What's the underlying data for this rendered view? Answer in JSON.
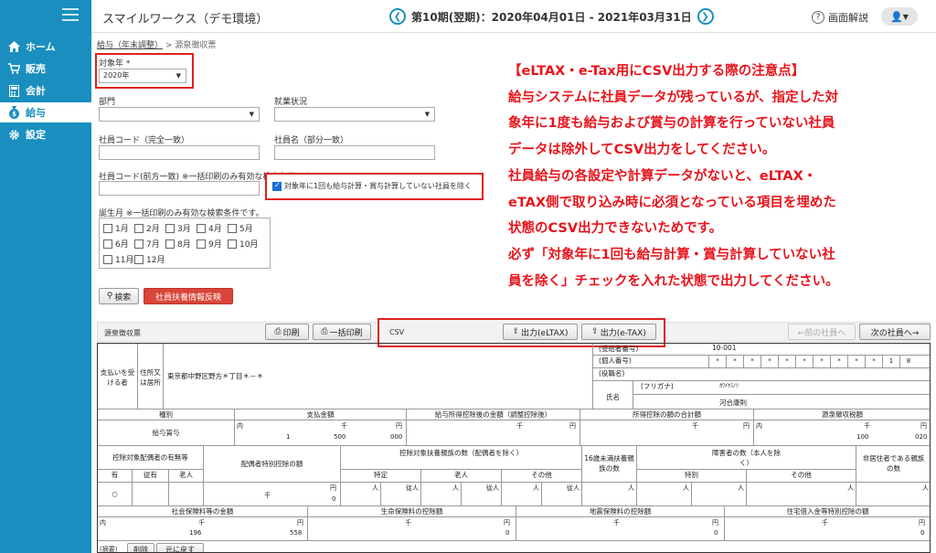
{
  "sidebar": {
    "items": [
      {
        "label": "ホーム",
        "icon": "home-icon"
      },
      {
        "label": "販売",
        "icon": "cart-icon"
      },
      {
        "label": "会計",
        "icon": "calculator-icon"
      },
      {
        "label": "給与",
        "icon": "money-bag-icon"
      },
      {
        "label": "設定",
        "icon": "gear-icon"
      }
    ]
  },
  "header": {
    "title": "スマイルワークス（デモ環境）",
    "period": "第10期(翌期)：2020年04月01日 - 2021年03月31日",
    "help": "画面解説"
  },
  "breadcrumb": {
    "parent": "給与（年末調整）",
    "sep": ">",
    "current": "源泉徴収票"
  },
  "form": {
    "target_year_label": "対象年 *",
    "target_year_value": "2020年",
    "dept_label": "部門",
    "employment_label": "就業状況",
    "code_exact_label": "社員コード（完全一致）",
    "name_partial_label": "社員名（部分一致）",
    "code_prefix_label": "社員コード(前方一致) ※一括印刷のみ有効な検索条件です。",
    "exclude_label": "対象年に1回も給与計算・賞与計算していない社員を除く",
    "birth_month_label": "誕生月 ※一括印刷のみ有効な検索条件です。",
    "months": [
      "1月",
      "2月",
      "3月",
      "4月",
      "5月",
      "6月",
      "7月",
      "8月",
      "9月",
      "10月",
      "11月",
      "12月"
    ],
    "search_btn": "検索",
    "reflect_btn": "社員扶養情報反映"
  },
  "notice": {
    "lines": [
      "【eLTAX・e-Tax用にCSV出力する際の注意点】",
      "給与システムに社員データが残っているが、指定した対",
      "象年に1度も給与および賞与の計算を行っていない社員",
      "データは除外してCSV出力をしてください。",
      "社員給与の各設定や計算データがないと、eLTAX・",
      "eTAX側で取り込み時に必須となっている項目を埋めた",
      "状態のCSV出力できないためです。",
      "必ず「対象年に1回も給与計算・賞与計算していない社",
      "員を除く」チェックを入れた状態で出力してください。"
    ]
  },
  "toolbar": {
    "doc_label": "源泉徴収票",
    "print": "印刷",
    "bulk_print": "一括印刷",
    "csv_label": "CSV",
    "eltax": "出力(eLTAX)",
    "etax": "出力(e-TAX)",
    "prev": "←前の社員へ",
    "next": "次の社員へ→"
  },
  "slip": {
    "payee_label": "支払いを受ける者",
    "address_label": "住所又は居所",
    "address": "東京都中野区野方＊丁目＊－＊",
    "recipient_no_label": "(受給者番号)",
    "recipient_no": "10-001",
    "personal_no_label": "(個人番号)",
    "personal_no": [
      "*",
      "*",
      "*",
      "*",
      "*",
      "*",
      "*",
      "*",
      "*",
      "*",
      "1",
      "8"
    ],
    "position_label": "(役職名)",
    "name_label": "氏名",
    "furigana_label": "(フリガナ)",
    "furigana": "ｶﾜｲﾔｽﾉﾘ",
    "name": "河合康則",
    "type_label": "種別",
    "payment_label": "支払金額",
    "after_income_label": "給与所得控除後の金額（調整控除後）",
    "deduction_total_label": "所得控除の額の合計額",
    "tax_label": "源泉徴収税額",
    "type_value": "給与賞与",
    "payment_values": [
      "1",
      "500",
      "000"
    ],
    "tax_values": [
      "100",
      "020"
    ],
    "spouse_label": "控除対象配偶者の有無等",
    "spouse_special_label": "配偶者特別控除の額",
    "dependents_label": "控除対象扶養親族の数（配偶者を除く）",
    "under16_label": "16歳未満扶養親族の数",
    "disabled_label": "障害者の数（本人を除く）",
    "nonresident_label": "非居住者である親族の数",
    "cols_spouse": [
      "有",
      "従有",
      "老人"
    ],
    "cols_dep": [
      "特定",
      "老人",
      "その他"
    ],
    "cols_dis": [
      "特別",
      "その他"
    ],
    "spouse_mark": "○",
    "units": {
      "en": "円",
      "sen": "千",
      "nin": "人",
      "uchi": "内",
      "ju": "従人"
    },
    "social_label": "社会保険料等の金額",
    "life_label": "生命保険料の控除額",
    "quake_label": "地震保険料の控除額",
    "housing_label": "住宅借入金等特別控除の額",
    "social_values": [
      "196",
      "558"
    ],
    "zero": "0",
    "summary_label": "(摘要)",
    "delete_btn": "削除",
    "restore_btn": "元に戻す"
  },
  "colors": {
    "brand": "#1a8fbf",
    "alert": "#e8141c"
  }
}
